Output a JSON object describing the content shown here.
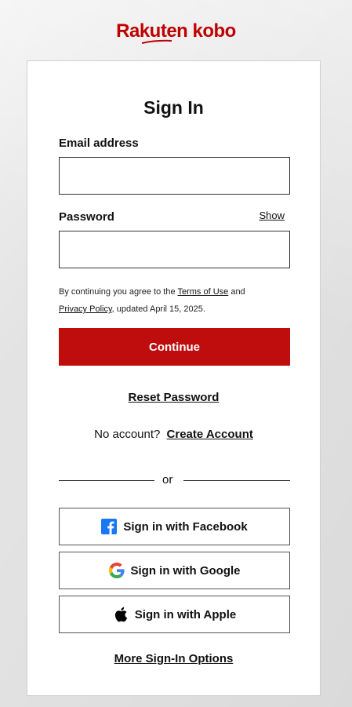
{
  "brand": {
    "logo_text": "Rakuten kobo",
    "color": "#bf0000"
  },
  "signin": {
    "title": "Sign In",
    "email_label": "Email address",
    "email_value": "",
    "password_label": "Password",
    "password_value": "",
    "show_label": "Show",
    "terms_prefix": "By continuing you agree to the ",
    "terms_link": "Terms of Use",
    "terms_and": " and",
    "privacy_link": "Privacy Policy",
    "terms_suffix": ", updated April 15, 2025.",
    "continue_label": "Continue",
    "continue_color": "#bf0d0d",
    "reset_password_label": "Reset Password",
    "no_account_text": "No account?",
    "create_account_label": "Create Account",
    "or_text": "or"
  },
  "social": {
    "facebook_label": "Sign in with Facebook",
    "google_label": "Sign in with Google",
    "apple_label": "Sign in with Apple",
    "more_options_label": "More Sign-In Options",
    "facebook_icon": "facebook-icon",
    "google_icon": "google-icon",
    "apple_icon": "apple-icon"
  }
}
